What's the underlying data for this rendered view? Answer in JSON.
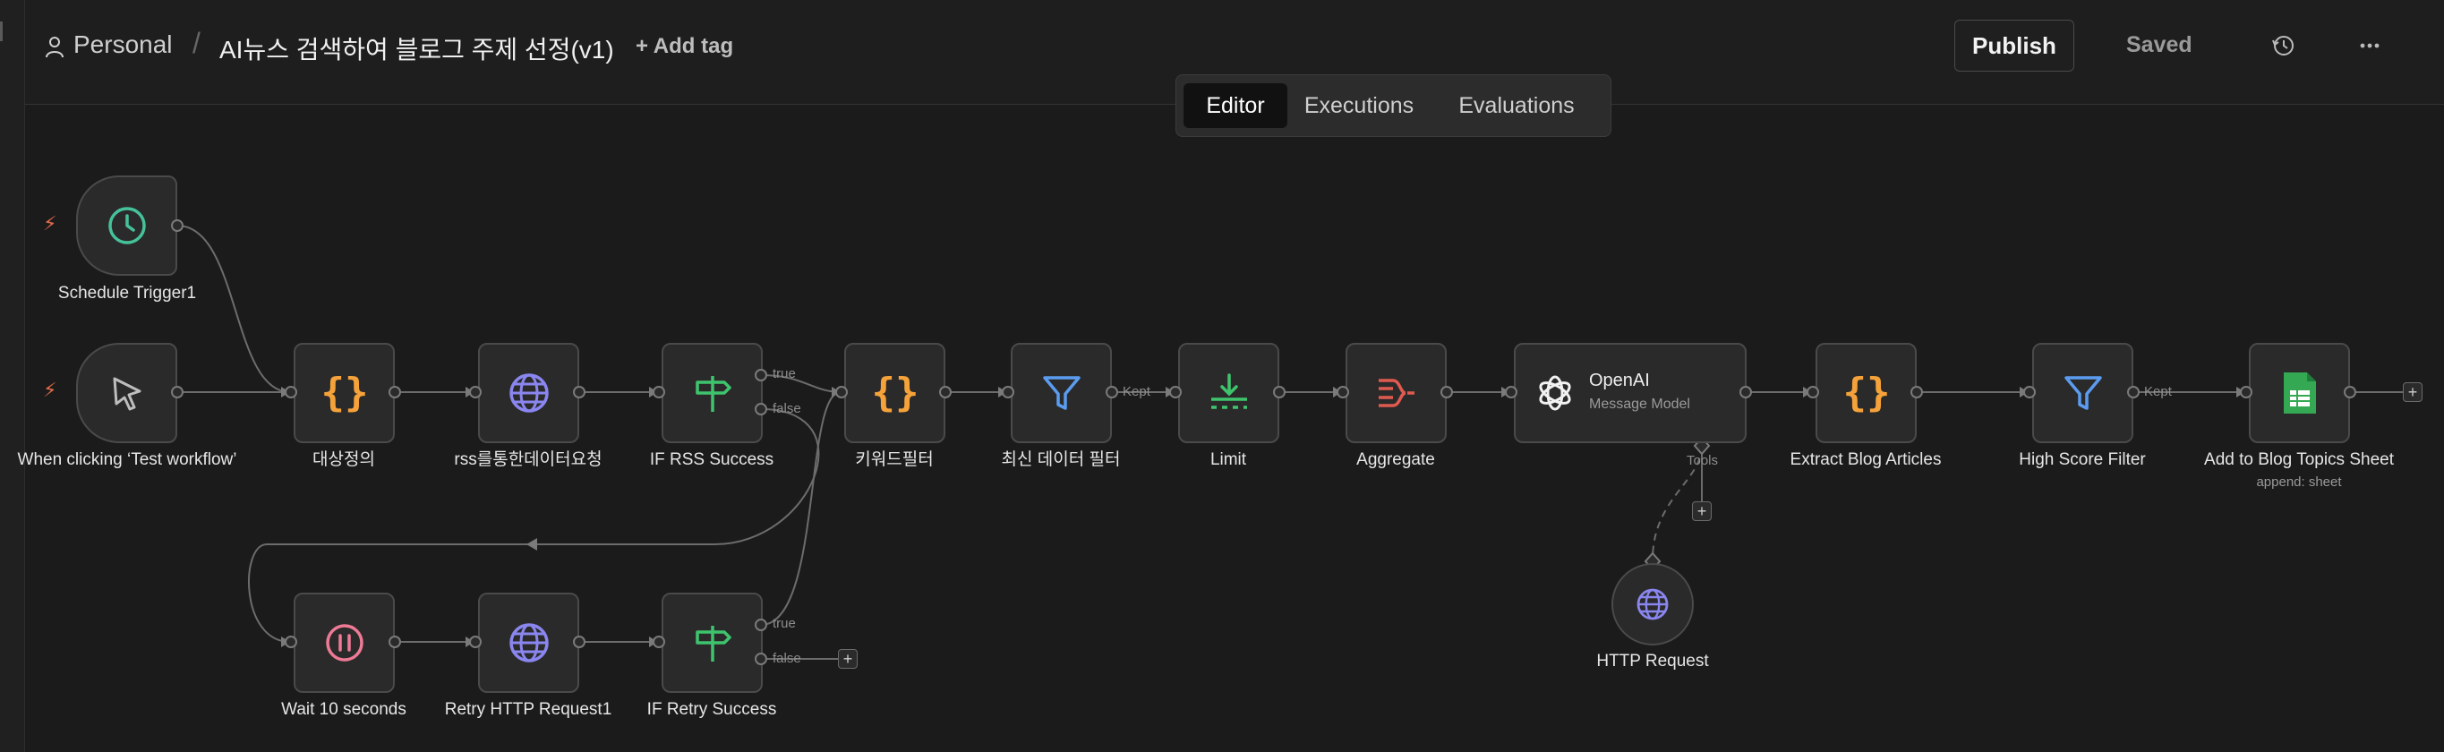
{
  "header": {
    "project": "Personal",
    "separator": "/",
    "workflow_name": "AI뉴스 검색하여 블로그 주제 선정(v1)",
    "add_tag": "+ Add tag",
    "publish": "Publish",
    "saved": "Saved"
  },
  "tabs": {
    "editor": "Editor",
    "executions": "Executions",
    "evaluations": "Evaluations"
  },
  "nodes": {
    "schedule": "Schedule Trigger1",
    "manual": "When clicking ‘Test workflow’",
    "define": "대상정의",
    "rss_request": "rss를통한데이터요청",
    "if_rss": "IF RSS Success",
    "keyword_filter": "키워드필터",
    "recent_filter": "최신 데이터 필터",
    "limit": "Limit",
    "aggregate": "Aggregate",
    "openai_title": "OpenAI",
    "openai_sub": "Message Model",
    "extract": "Extract Blog Articles",
    "high_score": "High Score Filter",
    "add_sheet": "Add to Blog Topics Sheet",
    "add_sheet_sub": "append: sheet",
    "http_request": "HTTP Request",
    "wait": "Wait 10 seconds",
    "retry_http": "Retry HTTP Request1",
    "if_retry": "IF Retry Success"
  },
  "edge_labels": {
    "true": "true",
    "false": "false",
    "kept": "Kept",
    "tools": "Tools"
  },
  "colors": {
    "code": "#f5a23a",
    "http": "#8a86ef",
    "if": "#3ec46d",
    "filter": "#5b9cf0",
    "limit": "#3ec46d",
    "aggregate": "#e05a4f",
    "sheets": "#34a853",
    "wait": "#ee7a96",
    "clock": "#45c29a"
  }
}
